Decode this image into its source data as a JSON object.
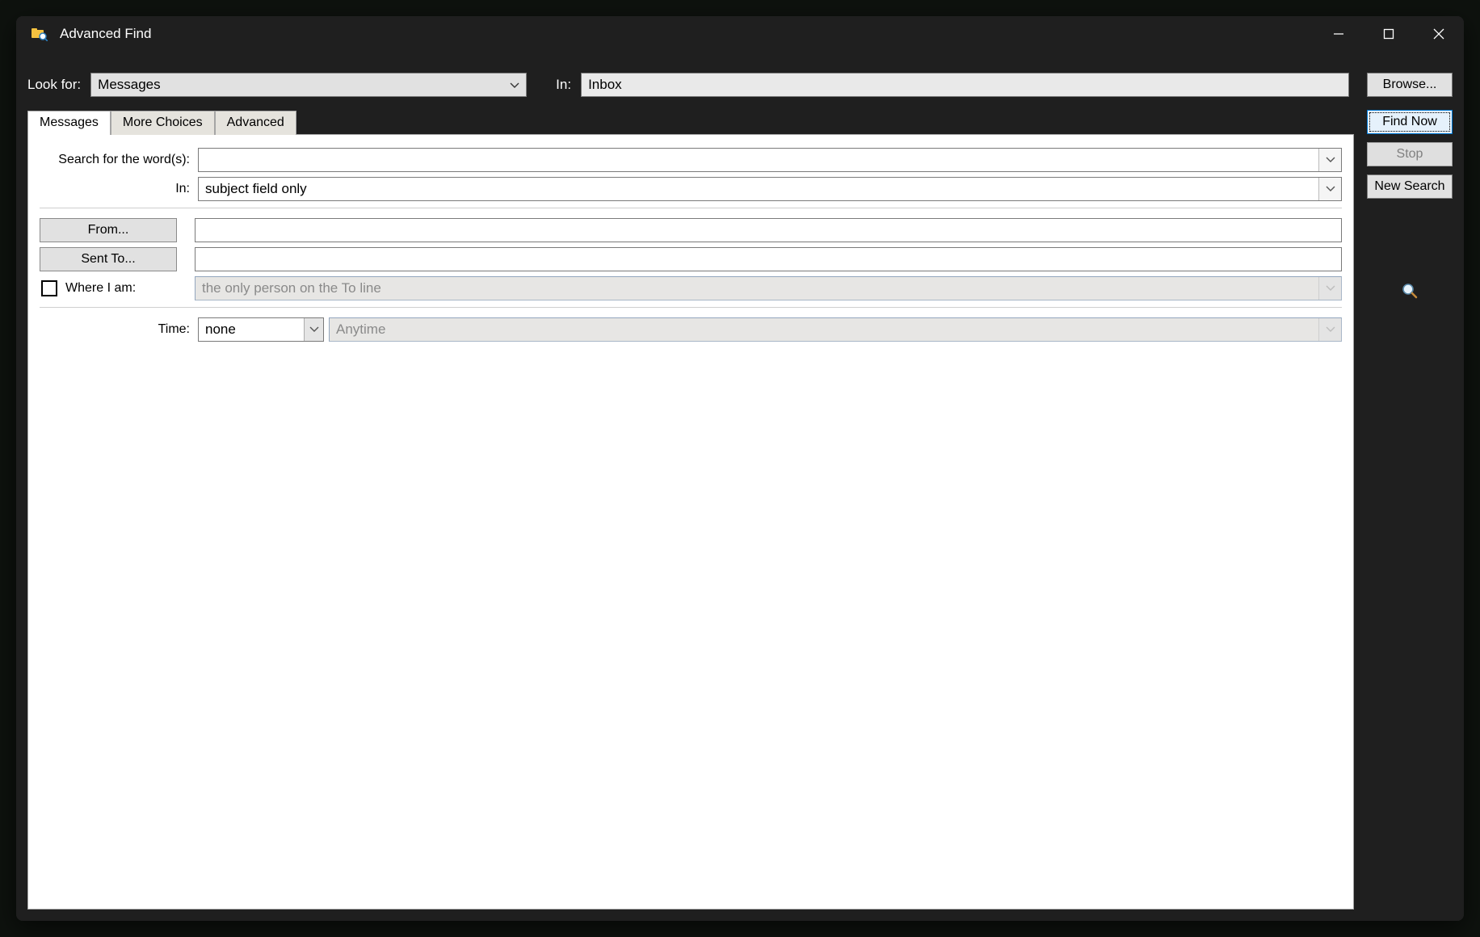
{
  "window": {
    "title": "Advanced Find"
  },
  "topbar": {
    "look_for_label": "Look for:",
    "look_for_value": "Messages",
    "in_label": "In:",
    "in_value": "Inbox",
    "browse_label": "Browse..."
  },
  "tabs": {
    "messages": "Messages",
    "more_choices": "More Choices",
    "advanced": "Advanced"
  },
  "form": {
    "search_words_label": "Search for the word(s):",
    "search_words_value": "",
    "in_label": "In:",
    "in_value": "subject field only",
    "from_label": "From...",
    "from_value": "",
    "sent_to_label": "Sent To...",
    "sent_to_value": "",
    "where_i_am_label": "Where I am:",
    "where_i_am_value": "the only person on the To line",
    "time_label": "Time:",
    "time_select_value": "none",
    "time_range_value": "Anytime"
  },
  "side": {
    "find_now": "Find Now",
    "stop": "Stop",
    "new_search": "New Search"
  }
}
